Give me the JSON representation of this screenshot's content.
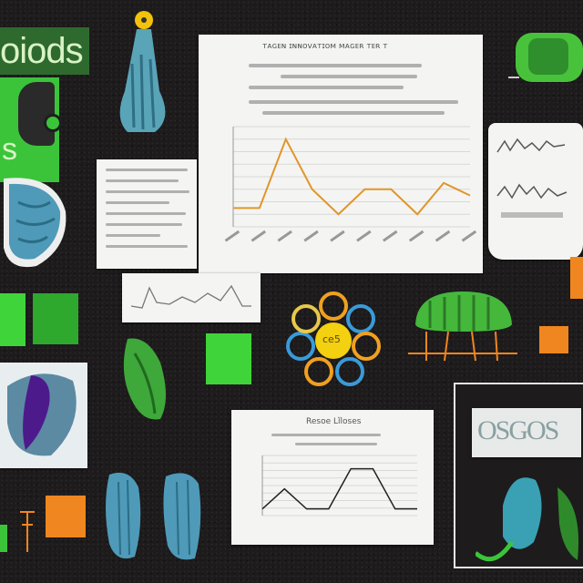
{
  "collage": {
    "logo_text": "oiods",
    "logo_fragment": "s",
    "flower_center_text": "ce5",
    "top_chart": {
      "title": "ᴛᴀɢᴇɴ ɪɴɴᴏᴠᴀᴛɪᴏᴍ ᴍᴀɢᴇʀ ᴛᴇʀ ᴛ",
      "series_color": "#e0962a"
    },
    "lower_chart": {
      "title": "Resoe Lǐloses",
      "series_color": "#222222"
    },
    "small_panel_text": "OSGOS",
    "colors": {
      "background": "#1d1b1c",
      "accent_green": "#3fd53a",
      "accent_orange": "#f0861f",
      "paper": "#f4f4f2",
      "leaf_blue": "#4f9ab8"
    }
  },
  "chart_data": [
    {
      "type": "line",
      "title": "",
      "x": [
        1,
        2,
        3,
        4,
        5,
        6,
        7,
        8,
        9,
        10
      ],
      "series": [
        {
          "values": [
            3,
            3,
            14,
            6,
            2,
            6,
            6,
            2,
            7,
            5
          ]
        }
      ],
      "ylim": [
        0,
        16
      ],
      "grid": true
    },
    {
      "type": "line",
      "title": "",
      "x": [
        1,
        2,
        3,
        4,
        5,
        6,
        7,
        8
      ],
      "series": [
        {
          "values": [
            1,
            4,
            1,
            1,
            7,
            7,
            1,
            1
          ]
        }
      ],
      "ylim": [
        0,
        9
      ],
      "grid": true
    }
  ]
}
